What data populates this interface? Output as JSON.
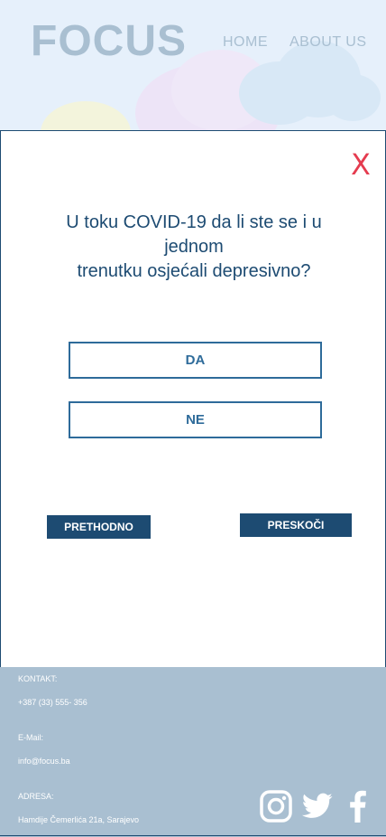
{
  "header": {
    "logo": "FOCUS",
    "nav": {
      "home": "HOME",
      "about": "ABOUT US"
    }
  },
  "modal": {
    "close": "X",
    "question_line1": "U toku COVID-19 da li ste se i u",
    "question_line2": "jednom",
    "question_line3": "trenutku osjećali depresivno?",
    "answer_yes": "DA",
    "answer_no": "NE",
    "prev": "PRETHODNO",
    "skip": "PRESKOČI"
  },
  "footer": {
    "contact_label": "KONTAKT:",
    "phone": "+387 (33) 555- 356",
    "email_label": "E-Mail:",
    "email": "info@focus.ba",
    "address_label": "ADRESA:",
    "address": "Hamdije Čemerlića 21a, Sarajevo"
  },
  "colors": {
    "primary": "#1d4b72",
    "accent_border": "#2e6b9a",
    "close": "#e53b4f",
    "footer_bg": "#a9bfd1",
    "header_bg": "#e6f0fb"
  },
  "icons": [
    "instagram-icon",
    "twitter-icon",
    "facebook-icon"
  ]
}
